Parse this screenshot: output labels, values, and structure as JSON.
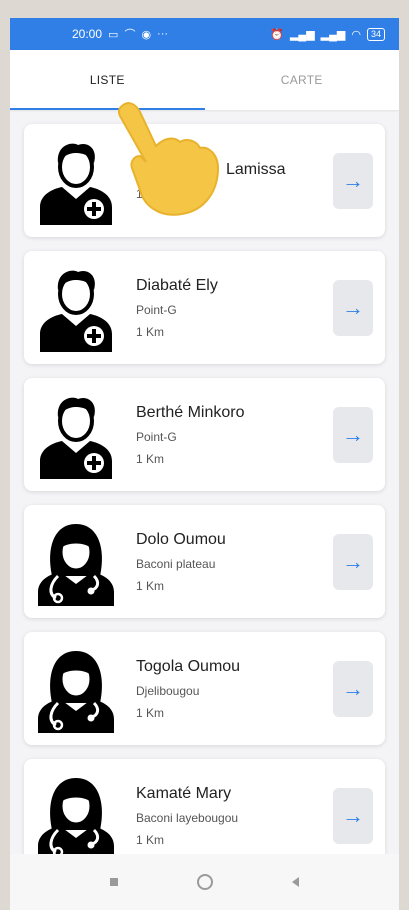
{
  "status_bar": {
    "time": "20:00",
    "battery": "34",
    "icons": [
      "screen-icon",
      "signal-arrow-icon",
      "messenger-icon",
      "more-icon",
      "alarm-icon",
      "signal-icon",
      "signal-icon",
      "wifi-icon",
      "battery-icon"
    ]
  },
  "tabs": [
    {
      "label": "LISTE",
      "active": true
    },
    {
      "label": "CARTE",
      "active": false
    }
  ],
  "doctors": [
    {
      "name": "Lamissa",
      "place": "",
      "distance": "1 K",
      "avatar": "male-doctor-icon"
    },
    {
      "name": "Diabaté Ely",
      "place": "Point-G",
      "distance": "1 Km",
      "avatar": "male-doctor-icon"
    },
    {
      "name": "Berthé Minkoro",
      "place": "Point-G",
      "distance": "1 Km",
      "avatar": "male-doctor-icon"
    },
    {
      "name": "Dolo Oumou",
      "place": "Baconi plateau",
      "distance": "1 Km",
      "avatar": "female-doctor-icon"
    },
    {
      "name": "Togola Oumou",
      "place": "Djelibougou",
      "distance": "1 Km",
      "avatar": "female-doctor-icon"
    },
    {
      "name": "Kamaté Mary",
      "place": "Baconi layebougou",
      "distance": "1 Km",
      "avatar": "female-doctor-icon"
    }
  ],
  "arrow_symbol": "→",
  "colors": {
    "accent": "#2f7fe6"
  }
}
